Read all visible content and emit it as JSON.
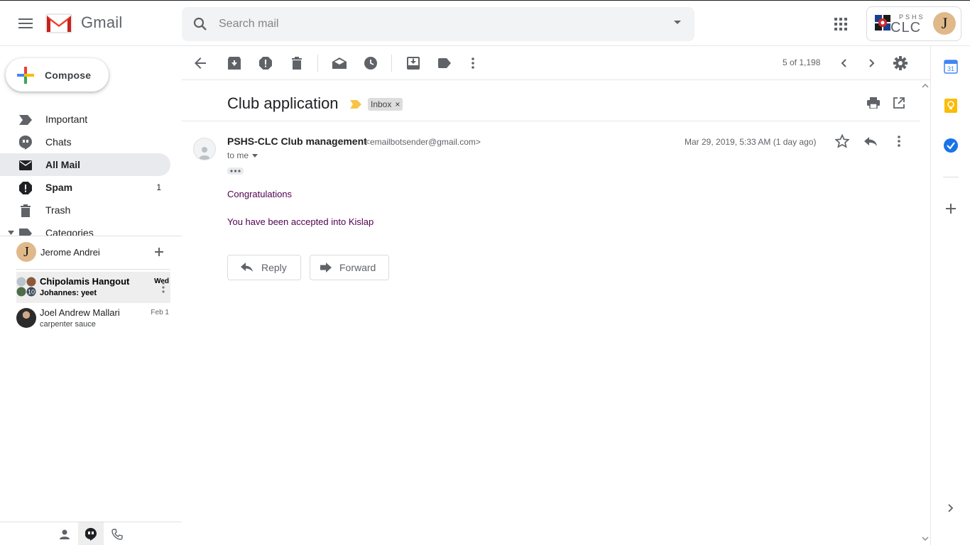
{
  "app": {
    "name": "Gmail",
    "search_placeholder": "Search mail",
    "org_small": "PSHS",
    "org_big": "CLC",
    "account_initial": "J"
  },
  "compose": {
    "label": "Compose"
  },
  "nav": {
    "items": [
      {
        "label": "Important",
        "icon": "label-important-icon"
      },
      {
        "label": "Chats",
        "icon": "chat-icon"
      },
      {
        "label": "All Mail",
        "icon": "mail-icon",
        "active": true
      },
      {
        "label": "Spam",
        "icon": "spam-icon",
        "count": "1"
      },
      {
        "label": "Trash",
        "icon": "trash-icon"
      },
      {
        "label": "Categories",
        "icon": "label-icon"
      }
    ]
  },
  "hangouts": {
    "me_name": "Jerome Andrei",
    "me_initial": "J",
    "conversations": [
      {
        "name": "Chipolamis Hangout",
        "preview": "Johannes: yeet",
        "date": "Wed",
        "badge": "10"
      },
      {
        "name": "Joel Andrew Mallari",
        "preview": "carpenter sauce",
        "date": "Feb 1"
      }
    ]
  },
  "toolbar": {
    "page_count": "5 of 1,198"
  },
  "message": {
    "subject": "Club application",
    "label": "Inbox",
    "label_close": "×",
    "sender_name": "PSHS-CLC Club management",
    "sender_email": "<emailbotsender@gmail.com>",
    "to": "to me",
    "date": "Mar 29, 2019, 5:33 AM (1 day ago)",
    "body": [
      "Congratulations",
      "You have been accepted into Kislap"
    ],
    "reply_label": "Reply",
    "forward_label": "Forward"
  },
  "side_panel": {
    "calendar_day": "31"
  },
  "colors": {
    "gmail_red": "#ea4335",
    "active_nav": "#e8eaed",
    "body_text": "#500050",
    "important_marker": "#f6c344",
    "calendar_blue": "#4285f4",
    "keep_yellow": "#fbbc04",
    "tasks_blue": "#1a73e8"
  }
}
